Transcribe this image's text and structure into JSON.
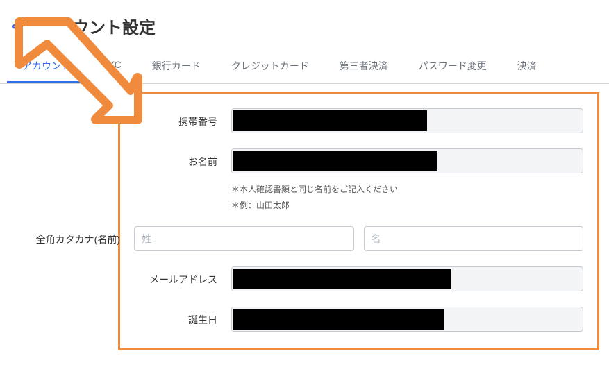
{
  "page": {
    "title": "アカウント設定"
  },
  "tabs": {
    "items": [
      {
        "label": "アカウント",
        "active": true
      },
      {
        "label": "KYC"
      },
      {
        "label": "銀行カード"
      },
      {
        "label": "クレジットカード"
      },
      {
        "label": "第三者決済"
      },
      {
        "label": "パスワード変更"
      },
      {
        "label": "決済"
      }
    ]
  },
  "form": {
    "phone_label": "携帯番号",
    "name_label": "お名前",
    "name_hint1": "＊本人確認書類と同じ名前をご記入ください",
    "name_hint2": "＊例：山田太郎",
    "kana_label": "全角カタカナ(名前)",
    "kana_sei_placeholder": "姓",
    "kana_mei_placeholder": "名",
    "email_label": "メールアドレス",
    "birthdate_label": "誕生日"
  }
}
